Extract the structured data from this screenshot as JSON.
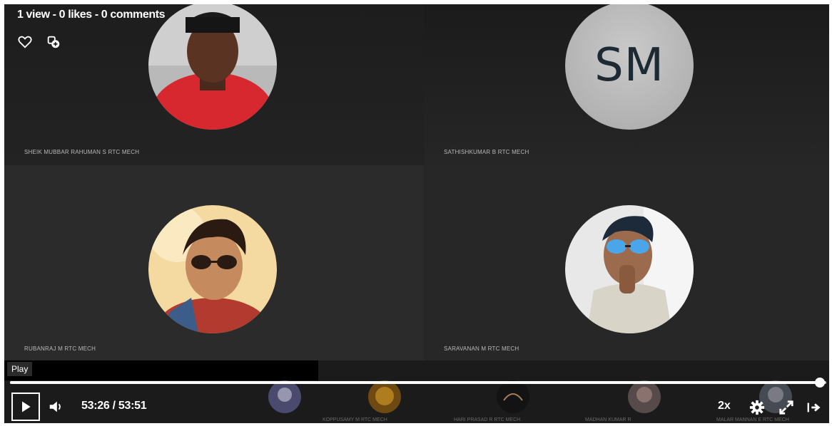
{
  "stats": {
    "text": "1 view - 0 likes - 0 comments"
  },
  "participants": [
    {
      "name": "SHEIK MUBBAR RAHUMAN S RTC MECH",
      "avatar": "photo"
    },
    {
      "name": "SATHISHKUMAR B RTC MECH",
      "avatar": "initials",
      "initials": "SM"
    },
    {
      "name": "RUBANRAJ M RTC MECH",
      "avatar": "photo"
    },
    {
      "name": "SARAVANAN M RTC MECH",
      "avatar": "photo"
    }
  ],
  "strip": [
    {
      "name": "KOPPUSAMY M RTC MECH"
    },
    {
      "name": "HARI PRASAD R RTC MECH"
    },
    {
      "name": "MADHAN KUMAR R"
    },
    {
      "name": "MALAR MANNAN E RTC MECH"
    }
  ],
  "player": {
    "tooltip": "Play",
    "current_time": "53:26",
    "separator": "/",
    "duration": "53:51",
    "progress": 0.992,
    "speed": "2x",
    "icons": {
      "like": "heart-icon",
      "collection": "add-to-collection-icon",
      "play": "play-icon",
      "volume": "volume-icon",
      "settings": "gear-icon",
      "fullscreen": "expand-icon",
      "share": "share-icon"
    }
  },
  "colors": {
    "background": "#1b1b1b",
    "initials_avatar": "#b8b8b8",
    "initials_text": "#1d2a33"
  }
}
